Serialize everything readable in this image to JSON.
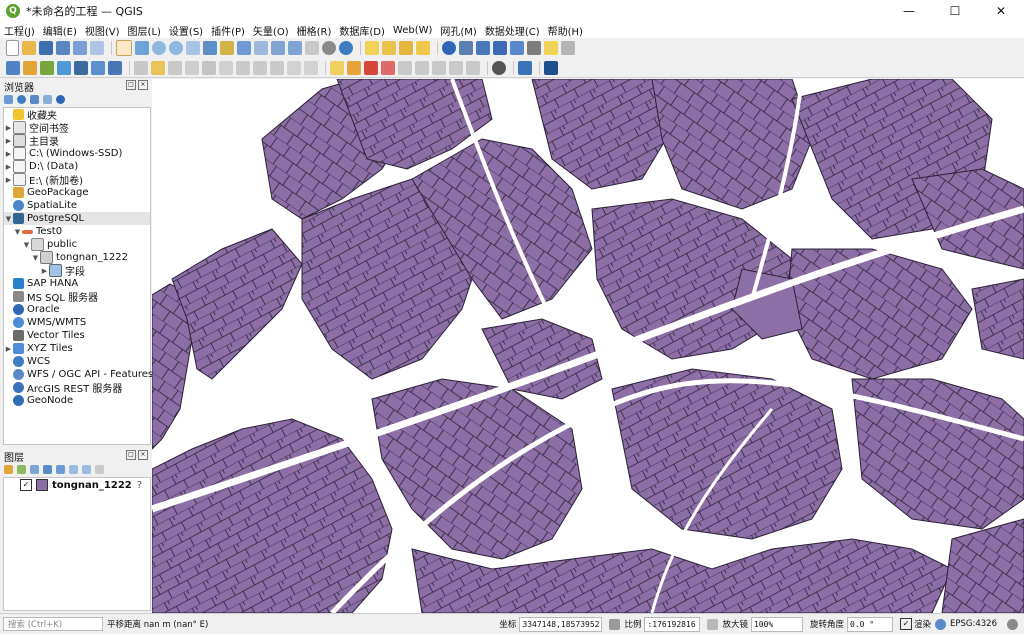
{
  "window": {
    "title": "*未命名的工程 — QGIS",
    "logo_letter": "Q",
    "controls": [
      "—",
      "☐",
      "✕"
    ]
  },
  "menus": [
    "工程(J)",
    "编辑(E)",
    "视图(V)",
    "图层(L)",
    "设置(S)",
    "插件(P)",
    "矢量(O)",
    "栅格(R)",
    "数据库(D)",
    "Web(W)",
    "网孔(M)",
    "数据处理(C)",
    "帮助(H)"
  ],
  "browser": {
    "title": "浏览器",
    "items": [
      {
        "label": "收藏夹",
        "icon": "star-icon"
      },
      {
        "label": "空间书签",
        "icon": "bookmark-icon"
      },
      {
        "label": "主目录",
        "icon": "home-icon"
      },
      {
        "label": "C:\\ (Windows-SSD)",
        "icon": "drive-icon"
      },
      {
        "label": "D:\\ (Data)",
        "icon": "drive-icon"
      },
      {
        "label": "E:\\ (新加卷)",
        "icon": "drive-icon"
      },
      {
        "label": "GeoPackage",
        "icon": "geopackage-icon"
      },
      {
        "label": "SpatiaLite",
        "icon": "spatialite-icon"
      },
      {
        "label": "PostgreSQL",
        "icon": "postgresql-icon"
      },
      {
        "label": "Test0",
        "icon": "connection-icon"
      },
      {
        "label": "public",
        "icon": "schema-icon"
      },
      {
        "label": "tongnan_1222",
        "icon": "table-icon"
      },
      {
        "label": "字段",
        "icon": "fields-icon"
      },
      {
        "label": "SAP HANA",
        "icon": "sap-hana-icon"
      },
      {
        "label": "MS SQL 服务器",
        "icon": "mssql-icon"
      },
      {
        "label": "Oracle",
        "icon": "oracle-icon"
      },
      {
        "label": "WMS/WMTS",
        "icon": "wms-icon"
      },
      {
        "label": "Vector Tiles",
        "icon": "vector-tiles-icon"
      },
      {
        "label": "XYZ Tiles",
        "icon": "xyz-tiles-icon"
      },
      {
        "label": "WCS",
        "icon": "wcs-icon"
      },
      {
        "label": "WFS / OGC API - Features",
        "icon": "wfs-icon"
      },
      {
        "label": "ArcGIS REST 服务器",
        "icon": "arcgis-icon"
      },
      {
        "label": "GeoNode",
        "icon": "geonode-icon"
      }
    ]
  },
  "layers_panel": {
    "title": "图层",
    "layer_name": "tongnan_1222",
    "checked": "✓",
    "layer_color": "#8b6fa6"
  },
  "status": {
    "search_placeholder": "搜索 (Ctrl+K)",
    "message": "平移距离 nan m (nan° E)",
    "coord_label": "坐标",
    "coord_value": "3347148,18573952",
    "scale_label": "比例",
    "scale_value": ":176192816",
    "magnifier_label": "放大镜",
    "magnifier_value": "100%",
    "rotation_label": "旋转角度",
    "rotation_value": "0.0 °",
    "render_label": "渲染",
    "crs": "EPSG:4326"
  }
}
